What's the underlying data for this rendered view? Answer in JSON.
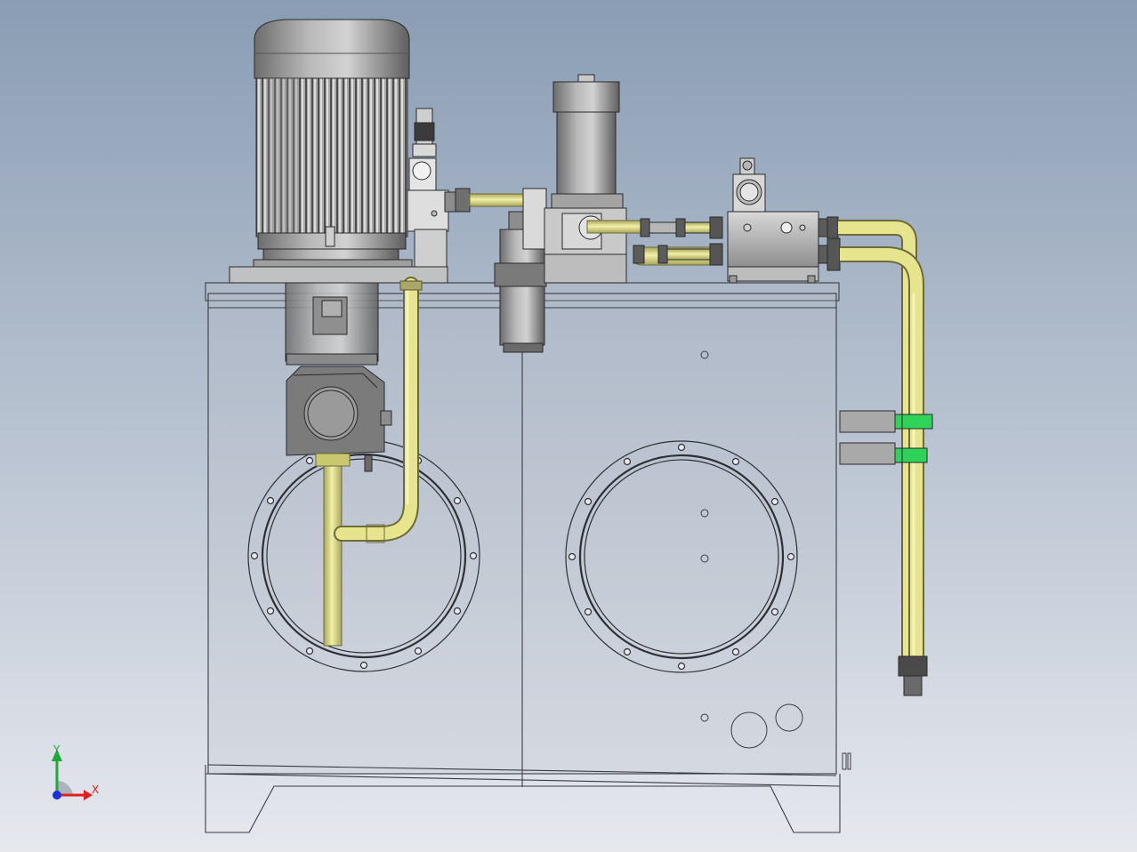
{
  "triad": {
    "y_label": "Y",
    "x_label": "X",
    "colors": {
      "x": "#e0201b",
      "y": "#1fa83c",
      "z": "#1c2fd6"
    }
  },
  "colors": {
    "bg_top": "#8a9db4",
    "bg_bottom": "#e6e8ee",
    "pipe": "#e2e08a",
    "pipe_dark": "#a8a65a",
    "green_fitting": "#2fd35a"
  }
}
